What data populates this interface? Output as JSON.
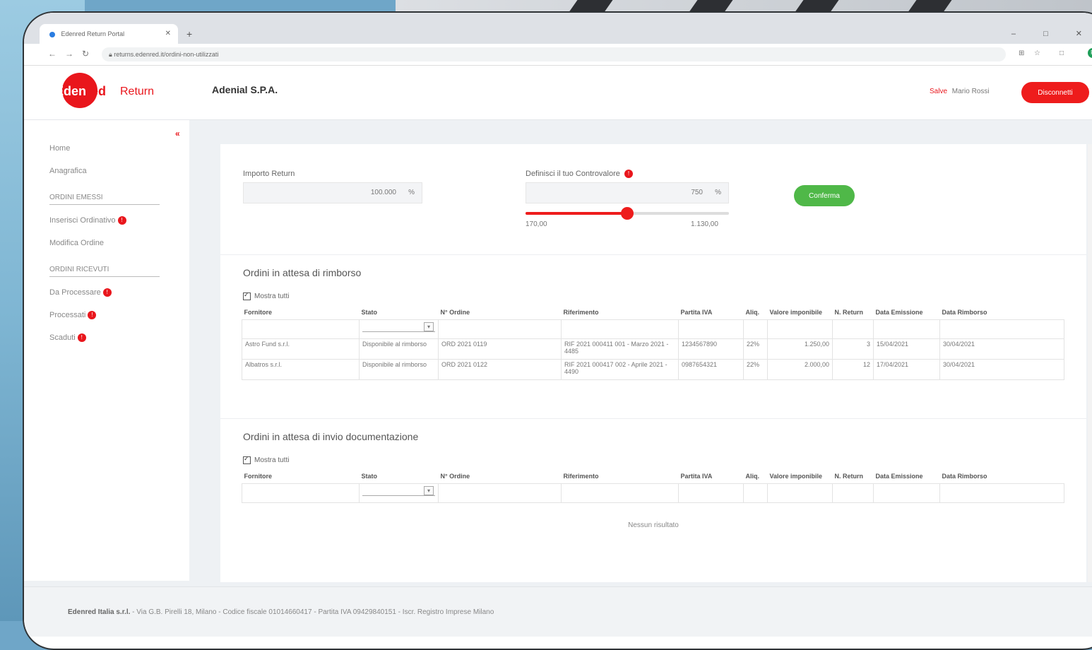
{
  "browser": {
    "tab_title": "Edenred Return Portal",
    "url": "returns.edenred.it/ordini-non-utilizzati",
    "win_controls": "– □ ✕"
  },
  "header": {
    "logo_text_a": "Eden",
    "logo_text_b": "red",
    "logo_text_c": "Return",
    "company": "Adenial S.P.A.",
    "user_label": "Salve",
    "user_name": "Mario Rossi",
    "logout_label": "Disconnetti"
  },
  "sidebar": {
    "collapse_icon": "«",
    "items_top": [
      "Home",
      "Anagrafica"
    ],
    "section1": "Ordini Emessi",
    "section1_items": [
      {
        "label": "Inserisci Ordinativo",
        "badge": "!"
      },
      {
        "label": "Modifica Ordine",
        "badge": ""
      }
    ],
    "section2": "Ordini Ricevuti",
    "section2_items": [
      {
        "label": "Da Processare",
        "badge": "!"
      },
      {
        "label": "Processati",
        "badge": "!"
      },
      {
        "label": "Scaduti",
        "badge": "!"
      }
    ]
  },
  "form": {
    "label_left": "Importo Return",
    "value_left": "100.000",
    "unit_left": "%",
    "label_right": "Definisci il tuo Controvalore",
    "info_badge": "!",
    "value_right": "750",
    "unit_right": "%",
    "slider_fraction": 0.5,
    "range_min": "170,00",
    "range_max": "1.130,00",
    "confirm_label": "Conferma"
  },
  "section1": {
    "title": "Ordini in attesa di rimborso",
    "select_all": "Mostra tutti",
    "columns": [
      "Fornitore",
      "Stato",
      "N° Ordine",
      "Riferimento",
      "Partita IVA",
      "Aliq.",
      "Valore imponibile",
      "N. Return",
      "Data Emissione",
      "Data Rimborso"
    ],
    "rows": [
      [
        "Astro Fund s.r.l.",
        "Disponibile al rimborso",
        "ORD 2021 0119",
        "RIF 2021 000411 001 - Marzo 2021 - 4485",
        "1234567890",
        "22%",
        "1.250,00",
        "3",
        "15/04/2021",
        "30/04/2021"
      ],
      [
        "Albatros s.r.l.",
        "Disponibile al rimborso",
        "ORD 2021 0122",
        "RIF 2021 000417 002 - Aprile 2021 - 4490",
        "0987654321",
        "22%",
        "2.000,00",
        "12",
        "17/04/2021",
        "30/04/2021"
      ]
    ]
  },
  "section2": {
    "title": "Ordini in attesa di invio documentazione",
    "select_all": "Mostra tutti",
    "columns": [
      "Fornitore",
      "Stato",
      "N° Ordine",
      "Riferimento",
      "Partita IVA",
      "Aliq.",
      "Valore imponibile",
      "N. Return",
      "Data Emissione",
      "Data Rimborso"
    ],
    "empty": "Nessun risultato"
  },
  "footer": {
    "company": "Edenred Italia s.r.l.",
    "details": "- Via G.B. Pirelli 18, Milano - Codice fiscale 01014660417 - Partita IVA 09429840151 - Iscr. Registro Imprese Milano"
  }
}
